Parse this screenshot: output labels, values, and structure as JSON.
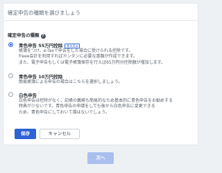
{
  "card": {
    "title": "確定申告の種類を選びましょう"
  },
  "section": {
    "label": "確定申告の種類"
  },
  "options": [
    {
      "title": "青色申告 55万円控除",
      "badge": "オススメ",
      "selected": true,
      "lines": [
        "帳簿をつけ、e-Taxで申告をした場合に受けられる控除です。",
        "freee会計を利用すればカンタンに必要な書類が作成できます。",
        "また、電子申告もしくは電子帳簿保存を行えば65万円分控除額が増加します。"
      ]
    },
    {
      "title": "青色申告 10万円控除",
      "selected": false,
      "lines": [
        "簡易帳簿による申告の場合はこちらを選択しましょう。"
      ]
    },
    {
      "title": "白色申告",
      "selected": false,
      "lines": [
        "白色申告は控除がなく、記帳の義務も簡易的なため基本的に青色申告をお勧めする",
        "特典が少ないです。青色申告の申請をしても後から白色申告に変更できる",
        "ため、青色申告にしておいて損はないでしょう。"
      ]
    }
  ],
  "buttons": {
    "save": "保存",
    "cancel": "キャンセル",
    "next": "次へ"
  },
  "colors": {
    "primary": "#2d62d5",
    "primary_disabled": "#a9bfee",
    "background": "#eef1f4"
  }
}
